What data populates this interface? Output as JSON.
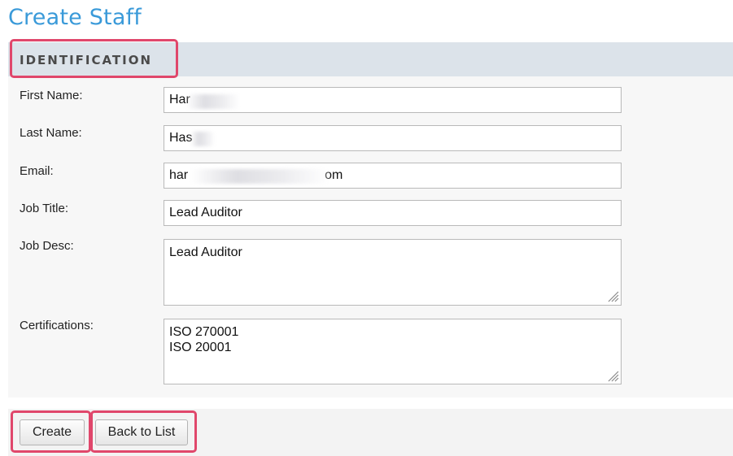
{
  "page": {
    "title": "Create Staff"
  },
  "section": {
    "title": "IDENTIFICATION"
  },
  "fields": {
    "first_name": {
      "label": "First Name:",
      "value": "Har"
    },
    "last_name": {
      "label": "Last Name:",
      "value": "Has"
    },
    "email": {
      "label": "Email:",
      "value_start": "har",
      "value_end": "om"
    },
    "job_title": {
      "label": "Job Title:",
      "value": "Lead Auditor"
    },
    "job_desc": {
      "label": "Job Desc:",
      "value": "Lead Auditor"
    },
    "certifications": {
      "label": "Certifications:",
      "value": "ISO 270001\nISO 20001"
    }
  },
  "buttons": {
    "create": "Create",
    "back_to_list": "Back to List"
  },
  "colors": {
    "title": "#3a9ad9",
    "section_header_bg": "#dce3ea",
    "highlight": "#e0476b"
  },
  "icons": {
    "textarea_resize": "resize-grip-icon"
  }
}
